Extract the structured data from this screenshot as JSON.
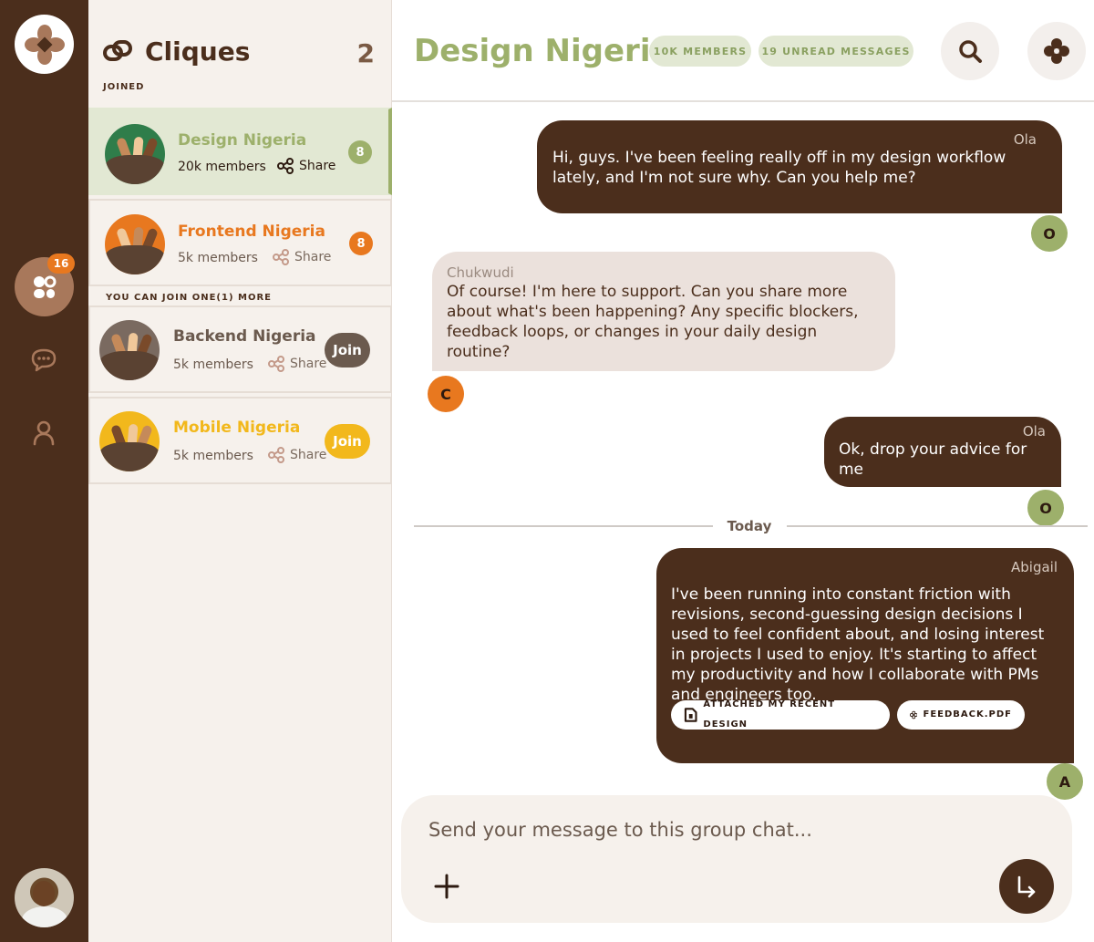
{
  "rail": {
    "cliques_badge": "16"
  },
  "panel": {
    "title": "Cliques",
    "count": "2",
    "joined_label": "JOINED",
    "more_label": "YOU CAN JOIN ONE(1) MORE",
    "share_label": "Share",
    "join_label": "Join",
    "cliques": [
      {
        "name": "Design Nigeria",
        "members": "20k members",
        "badge": "8",
        "color": "#9db06b",
        "avatar_bg": "#2f7d4a",
        "joined": true
      },
      {
        "name": "Frontend Nigeria",
        "members": "5k members",
        "badge": "8",
        "color": "#e8781f",
        "avatar_bg": "#e8781f",
        "joined": true
      },
      {
        "name": "Backend Nigeria",
        "members": "5k members",
        "color": "#6b5a4e",
        "avatar_bg": "#7a6a60",
        "joined": false
      },
      {
        "name": "Mobile Nigeria",
        "members": "5k members",
        "color": "#f2b81c",
        "avatar_bg": "#f2b81c",
        "joined": false
      }
    ]
  },
  "chat": {
    "title": "Design Nigeria",
    "members_pill": "10K MEMBERS",
    "unread_pill": "19 UNREAD MESSAGES",
    "divider": "Today",
    "messages": [
      {
        "sender": "Ola",
        "initial": "O",
        "text": "Hi, guys. I've been feeling really off in my design workflow lately, and I'm not sure why. Can you help me?"
      },
      {
        "sender": "Chukwudi",
        "initial": "C",
        "text": "Of course! I'm here to support.  Can you share more about what's been happening? Any specific blockers, feedback loops, or changes in your daily design routine?"
      },
      {
        "sender": "Ola",
        "initial": "O",
        "text": "Ok, drop your advice for me"
      },
      {
        "sender": "Abigail",
        "initial": "A",
        "text": "I've been running into constant friction with revisions, second-guessing design decisions I used to feel confident about, and losing interest in projects I used to enjoy. It's starting to affect my productivity and how I collaborate with PMs and engineers too.",
        "attachments": [
          "ATTACHED MY RECENT DESIGN",
          "FEEDBACK.PDF"
        ]
      }
    ],
    "composer_placeholder": "Send your message to this group chat..."
  },
  "colors": {
    "brown": "#4b2e1c",
    "green": "#9db06b",
    "orange": "#e8781f",
    "yellow": "#f2b81c"
  }
}
